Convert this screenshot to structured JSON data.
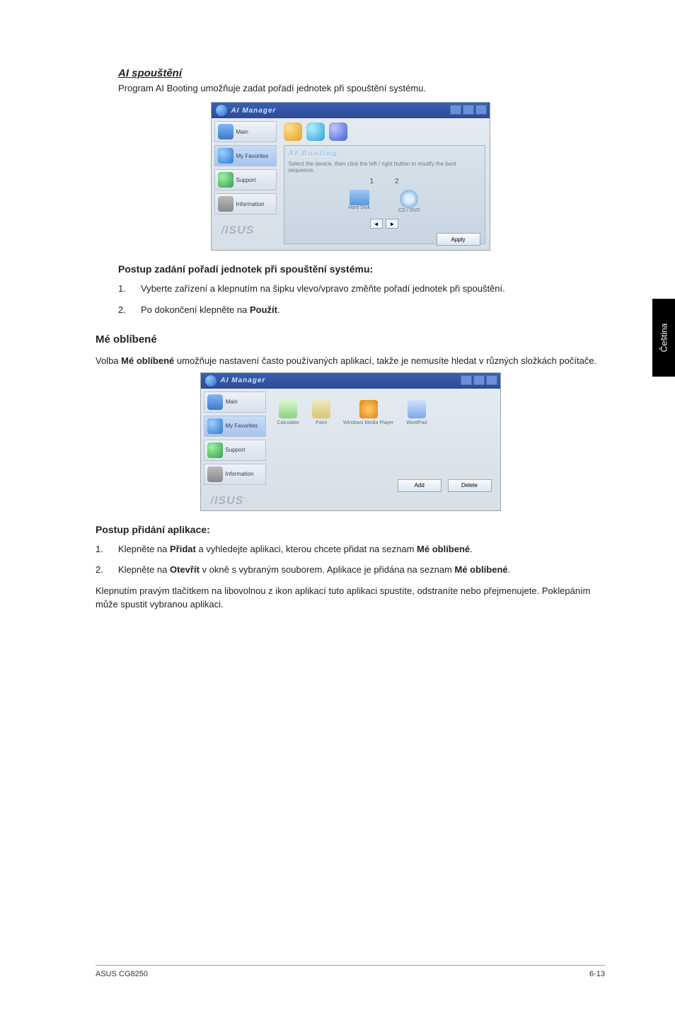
{
  "side_tab": "Čeština",
  "section1": {
    "heading": "AI spouštění",
    "lead": "Program AI Booting umožňuje zadat pořadí jednotek při spouštění systému.",
    "shot": {
      "title": "AI Manager",
      "side": {
        "main": "Main",
        "fav": "My Favorites",
        "support": "Support",
        "info": "Information"
      },
      "brand": "/ISUS",
      "panel": {
        "title": "AI Booting",
        "desc": "Select the device, then click the left / right button to modify the boot sequence.",
        "slot1": "1",
        "slot2": "2",
        "dev1": "Hard Disk",
        "dev2": "CD / DVD",
        "apply": "Apply"
      }
    },
    "steps_heading": "Postup zadání pořadí jednotek při spouštění systému:",
    "steps": [
      "Vyberte zařízení a klepnutím na šipku vlevo/vpravo změňte pořadí jednotek při spouštění.",
      "Po dokončení klepněte na "
    ],
    "step2_bold": "Použít",
    "step2_tail": "."
  },
  "section2": {
    "heading": "Mé oblíbené",
    "lead_pre": "Volba ",
    "lead_bold": "Mé oblíbené",
    "lead_post": " umožňuje nastavení často používaných aplikací, takže je nemusíte hledat v různých složkách počítače.",
    "shot": {
      "title": "AI Manager",
      "side": {
        "main": "Main",
        "fav": "My Favorites",
        "support": "Support",
        "info": "Information"
      },
      "brand": "/ISUS",
      "apps": {
        "calc": "Calculator",
        "paint": "Paint",
        "wmp": "Windows Media Player",
        "wpad": "WordPad"
      },
      "add": "Add",
      "delete": "Delete"
    },
    "add_heading": "Postup přidání aplikace:",
    "add_steps": {
      "s1_pre": "Klepněte na ",
      "s1_b1": "Přidat",
      "s1_mid": " a vyhledejte aplikaci, kterou chcete přidat na seznam ",
      "s1_b2": "Mé oblíbené",
      "s1_tail": ".",
      "s2_pre": "Klepněte na ",
      "s2_b1": "Otevřít",
      "s2_mid": " v okně s vybraným souborem. Aplikace je přidána na seznam ",
      "s2_b2": "Mé oblíbené",
      "s2_tail": "."
    },
    "closing": "Klepnutím pravým tlačítkem na libovolnou z ikon aplikací tuto aplikaci spustíte, odstraníte nebo přejmenujete. Poklepáním může spustit vybranou aplikaci."
  },
  "footer": {
    "left": "ASUS CG8250",
    "right": "6-13"
  }
}
